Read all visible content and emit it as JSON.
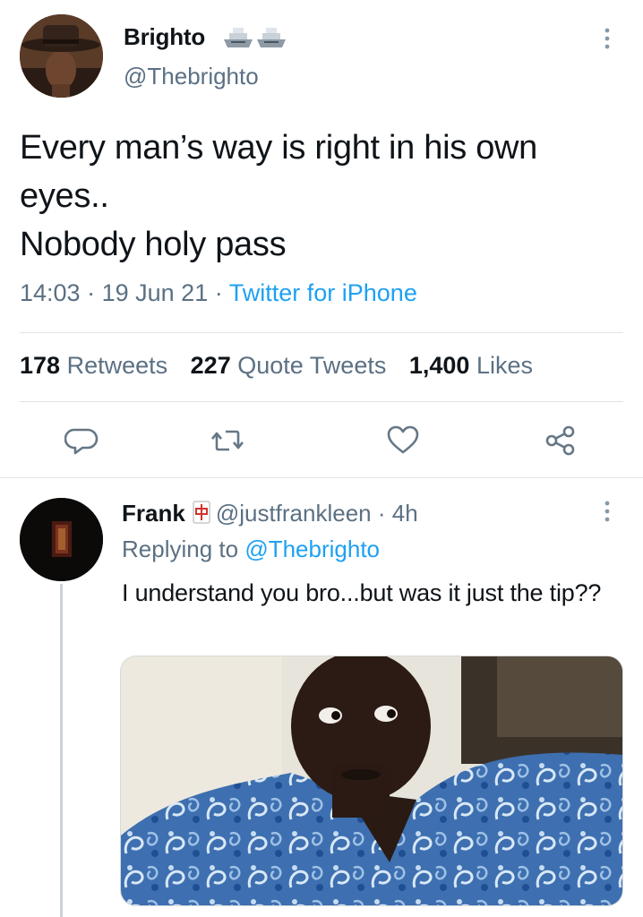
{
  "tweet": {
    "author_name": "Brighto",
    "author_handle": "@Thebrighto",
    "badges": [
      "ship-emoji",
      "ship-emoji"
    ],
    "text": "Every man’s way is right in his own eyes..\nNobody holy pass",
    "time": "14:03",
    "date": "19 Jun 21",
    "source": "Twitter for iPhone",
    "stats": {
      "retweets": "178",
      "retweets_label": "Retweets",
      "quotes": "227",
      "quotes_label": "Quote Tweets",
      "likes": "1,400",
      "likes_label": "Likes"
    },
    "actions": [
      "reply-icon",
      "retweet-icon",
      "like-icon",
      "share-icon"
    ]
  },
  "reply": {
    "author_name": "Frank",
    "badge": "mahjong-emoji",
    "handle": "@justfrankleen",
    "age": "4h",
    "replying_label": "Replying to",
    "replying_to": "@Thebrighto",
    "text": "I understand you bro...but was it just the tip??",
    "media": "photo"
  },
  "colors": {
    "text": "#0f1419",
    "secondary": "#5b7083",
    "accent": "#1da1f2",
    "divider": "#dfe3e6"
  },
  "separator": "·"
}
